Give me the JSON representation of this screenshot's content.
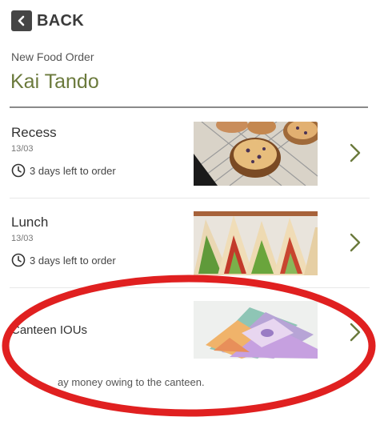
{
  "header": {
    "back_label": "BACK",
    "subtitle": "New Food Order",
    "student_name": "Kai Tando"
  },
  "orders": [
    {
      "name": "Recess",
      "date": "13/03",
      "due": "3 days left to order",
      "image": "muffins-photo"
    },
    {
      "name": "Lunch",
      "date": "13/03",
      "due": "3 days left to order",
      "image": "sandwiches-photo"
    }
  ],
  "iou": {
    "name": "Canteen IOUs",
    "description": "ay money owing to the canteen.",
    "image": "banknotes-photo"
  },
  "colors": {
    "title": "#6b7a3c",
    "chevron": "#6b7a3c",
    "annotation_circle": "#e02020"
  }
}
